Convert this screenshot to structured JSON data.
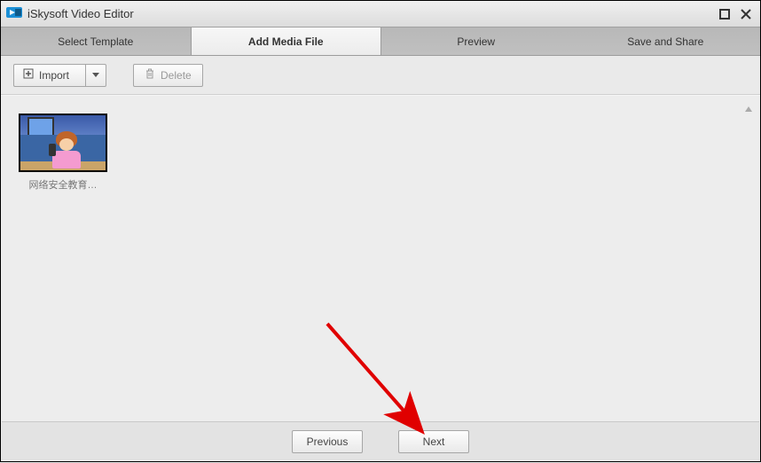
{
  "titlebar": {
    "app_title": "iSkysoft Video Editor"
  },
  "tabs": {
    "t0": "Select Template",
    "t1": "Add Media File",
    "t2": "Preview",
    "t3": "Save and Share",
    "active_index": 1
  },
  "toolbar": {
    "import_label": "Import",
    "delete_label": "Delete"
  },
  "media": {
    "item0_label": "网络安全教育…"
  },
  "footer": {
    "previous_label": "Previous",
    "next_label": "Next"
  }
}
